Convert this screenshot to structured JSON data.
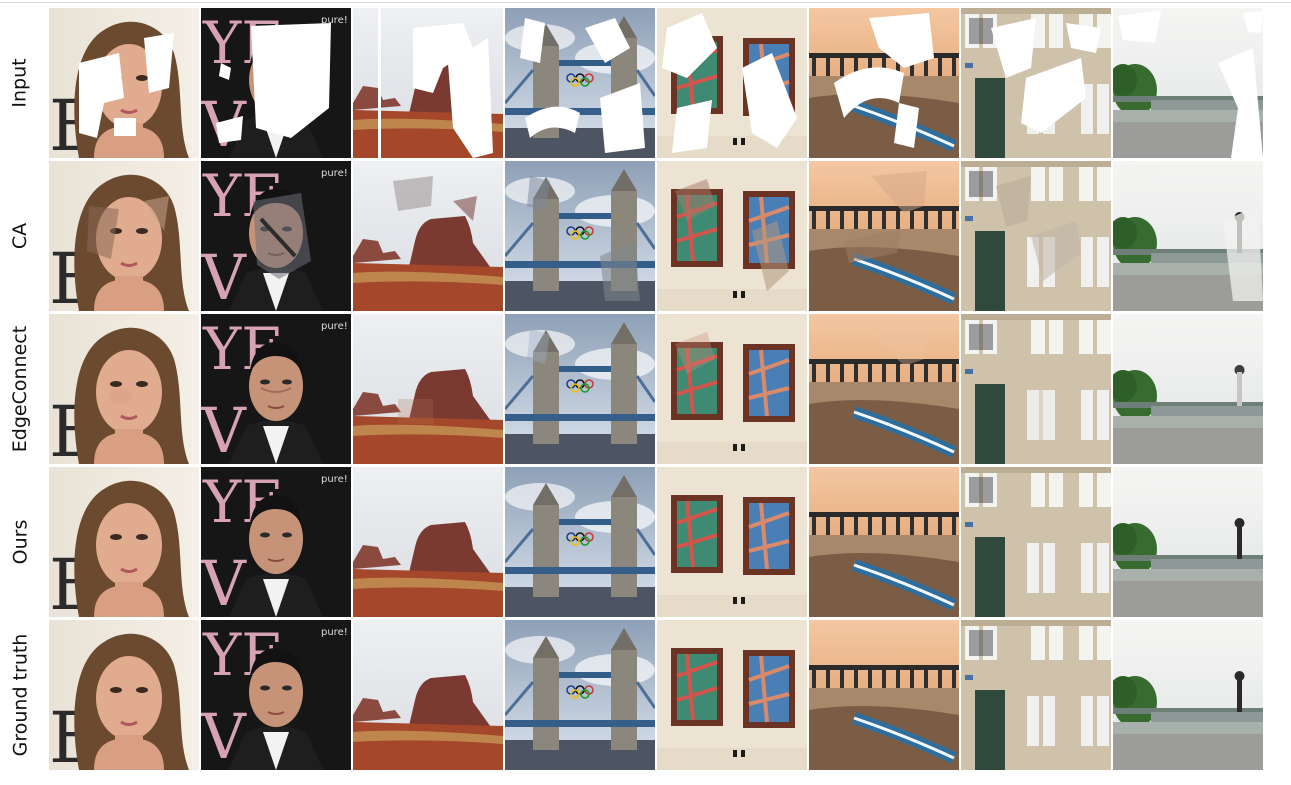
{
  "figure": {
    "row_labels": [
      "Input",
      "CA",
      "EdgeConnect",
      "Ours",
      "Ground truth"
    ],
    "scenes": [
      "woman-portrait",
      "man-portrait",
      "desert-butte",
      "tower-bridge",
      "framed-paintings",
      "pier-sunset",
      "building-facade",
      "river-bridge-park"
    ],
    "badge_text": "pure!",
    "colors": {
      "mask": "#ffffff",
      "label": "#111111",
      "divider": "#d9d9d9"
    }
  }
}
